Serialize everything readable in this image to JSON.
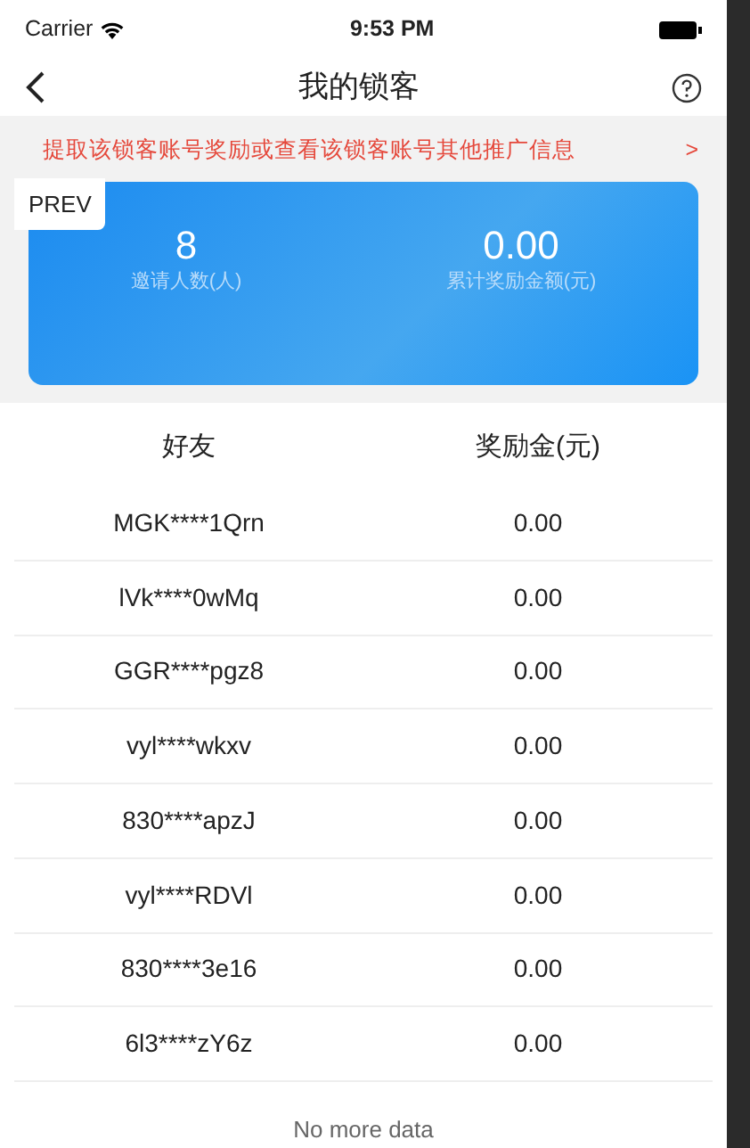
{
  "status_bar": {
    "carrier": "Carrier",
    "time": "9:53 PM"
  },
  "nav": {
    "title": "我的锁客"
  },
  "banner": {
    "text": "提取该锁客账号奖励或查看该锁客账号其他推广信息",
    "arrow": ">"
  },
  "prev_label": "PREV",
  "stats": [
    {
      "value": "8",
      "label": "邀请人数(人)"
    },
    {
      "value": "0.00",
      "label": "累计奖励金额(元)"
    }
  ],
  "table": {
    "columns": [
      "好友",
      "奖励金(元)"
    ],
    "rows": [
      [
        "MGK****1Qrn",
        "0.00"
      ],
      [
        "lVk****0wMq",
        "0.00"
      ],
      [
        "GGR****pgz8",
        "0.00"
      ],
      [
        "vyl****wkxv",
        "0.00"
      ],
      [
        "830****apzJ",
        "0.00"
      ],
      [
        "vyl****RDVl",
        "0.00"
      ],
      [
        "830****3e16",
        "0.00"
      ],
      [
        "6l3****zY6z",
        "0.00"
      ]
    ]
  },
  "footer": "No more data"
}
